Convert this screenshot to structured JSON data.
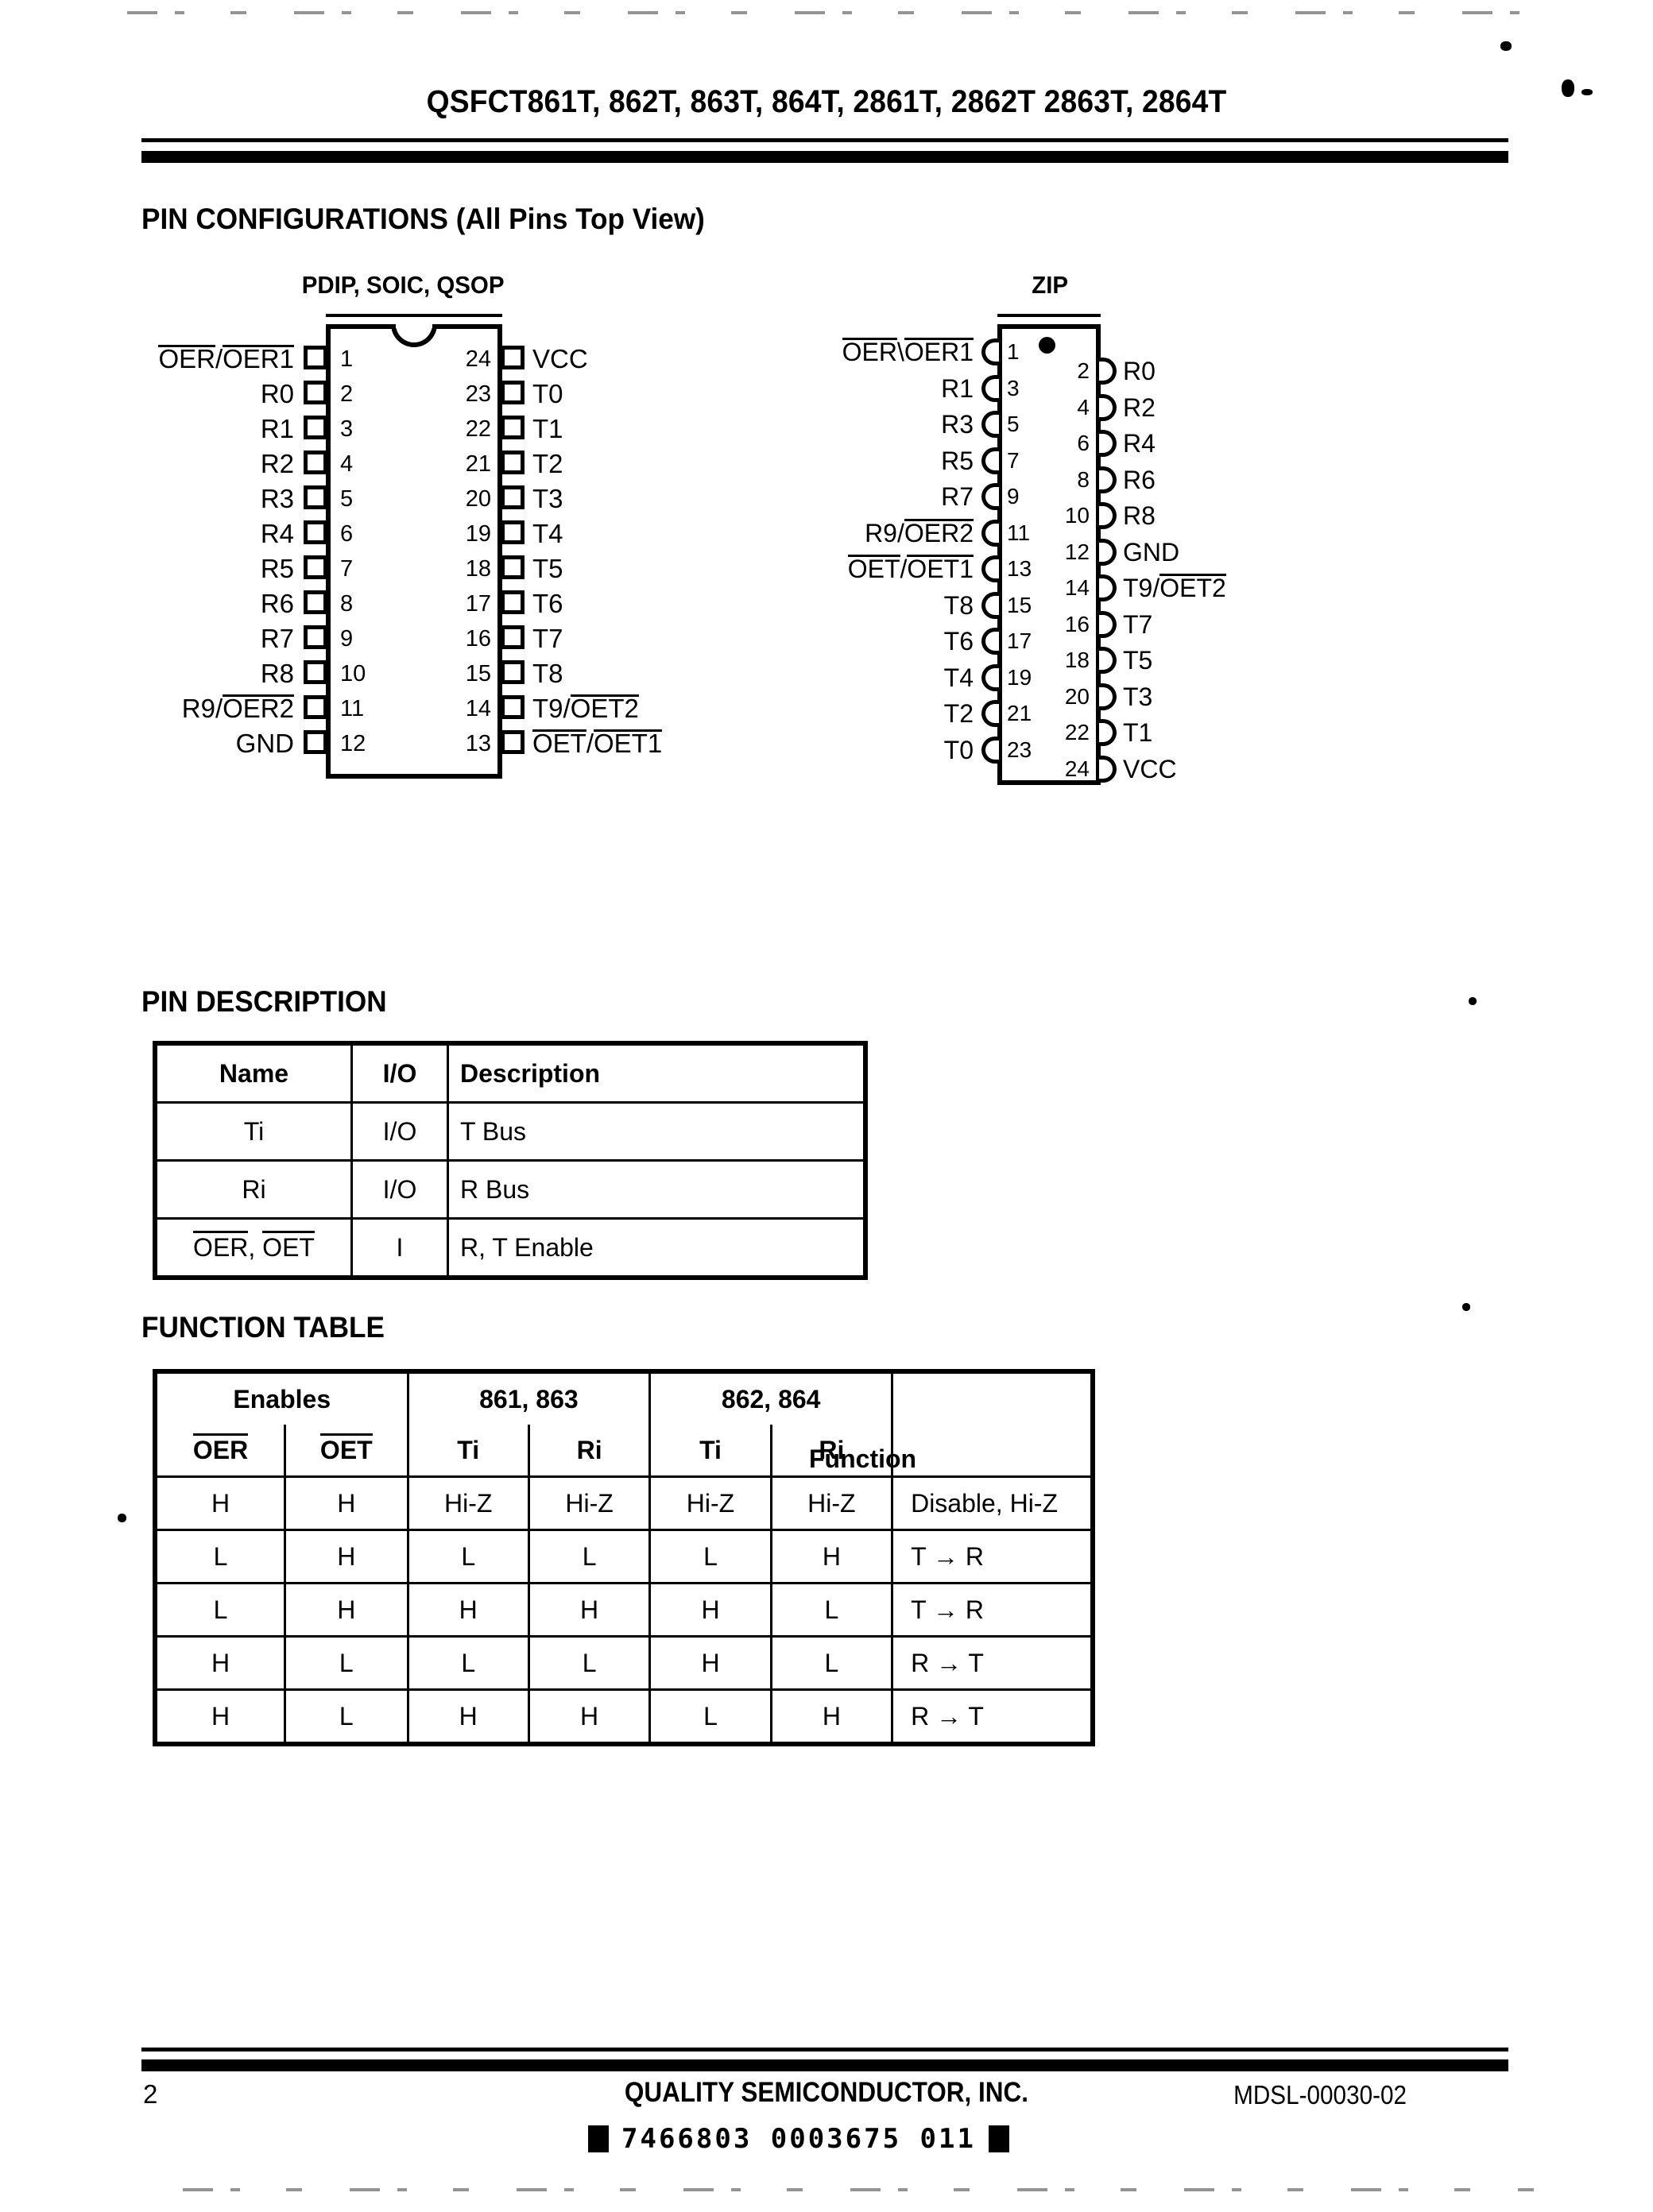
{
  "document": {
    "title": "QSFCT861T, 862T, 863T, 864T, 2861T, 2862T 2863T, 2864T",
    "page_number": "2",
    "company": "QUALITY SEMICONDUCTOR, INC.",
    "doc_code": "MDSL-00030-02",
    "ocr_code": "7466803 0003675 011"
  },
  "pin_configurations": {
    "heading": "PIN CONFIGURATIONS (All Pins Top View)",
    "dip": {
      "caption": "PDIP, SOIC, QSOP",
      "left_pins": [
        {
          "num": "1",
          "label": "OER/OER1",
          "overline": "both"
        },
        {
          "num": "2",
          "label": "R0",
          "overline": "none"
        },
        {
          "num": "3",
          "label": "R1",
          "overline": "none"
        },
        {
          "num": "4",
          "label": "R2",
          "overline": "none"
        },
        {
          "num": "5",
          "label": "R3",
          "overline": "none"
        },
        {
          "num": "6",
          "label": "R4",
          "overline": "none"
        },
        {
          "num": "7",
          "label": "R5",
          "overline": "none"
        },
        {
          "num": "8",
          "label": "R6",
          "overline": "none"
        },
        {
          "num": "9",
          "label": "R7",
          "overline": "none"
        },
        {
          "num": "10",
          "label": "R8",
          "overline": "none"
        },
        {
          "num": "11",
          "label": "R9/OER2",
          "overline": "second"
        },
        {
          "num": "12",
          "label": "GND",
          "overline": "none"
        }
      ],
      "right_pins": [
        {
          "num": "24",
          "label": "VCC",
          "overline": "none"
        },
        {
          "num": "23",
          "label": "T0",
          "overline": "none"
        },
        {
          "num": "22",
          "label": "T1",
          "overline": "none"
        },
        {
          "num": "21",
          "label": "T2",
          "overline": "none"
        },
        {
          "num": "20",
          "label": "T3",
          "overline": "none"
        },
        {
          "num": "19",
          "label": "T4",
          "overline": "none"
        },
        {
          "num": "18",
          "label": "T5",
          "overline": "none"
        },
        {
          "num": "17",
          "label": "T6",
          "overline": "none"
        },
        {
          "num": "16",
          "label": "T7",
          "overline": "none"
        },
        {
          "num": "15",
          "label": "T8",
          "overline": "none"
        },
        {
          "num": "14",
          "label": "T9/OET2",
          "overline": "second"
        },
        {
          "num": "13",
          "label": "OET/OET1",
          "overline": "both"
        }
      ]
    },
    "zip": {
      "caption": "ZIP",
      "left_pins": [
        {
          "num": "1",
          "label": "OER\\OER1",
          "overline": "both"
        },
        {
          "num": "3",
          "label": "R1",
          "overline": "none"
        },
        {
          "num": "5",
          "label": "R3",
          "overline": "none"
        },
        {
          "num": "7",
          "label": "R5",
          "overline": "none"
        },
        {
          "num": "9",
          "label": "R7",
          "overline": "none"
        },
        {
          "num": "11",
          "label": "R9/OER2",
          "overline": "second"
        },
        {
          "num": "13",
          "label": "OET/OET1",
          "overline": "both"
        },
        {
          "num": "15",
          "label": "T8",
          "overline": "none"
        },
        {
          "num": "17",
          "label": "T6",
          "overline": "none"
        },
        {
          "num": "19",
          "label": "T4",
          "overline": "none"
        },
        {
          "num": "21",
          "label": "T2",
          "overline": "none"
        },
        {
          "num": "23",
          "label": "T0",
          "overline": "none"
        }
      ],
      "right_pins": [
        {
          "num": "2",
          "label": "R0",
          "overline": "none"
        },
        {
          "num": "4",
          "label": "R2",
          "overline": "none"
        },
        {
          "num": "6",
          "label": "R4",
          "overline": "none"
        },
        {
          "num": "8",
          "label": "R6",
          "overline": "none"
        },
        {
          "num": "10",
          "label": "R8",
          "overline": "none"
        },
        {
          "num": "12",
          "label": "GND",
          "overline": "none"
        },
        {
          "num": "14",
          "label": "T9/OET2",
          "overline": "second"
        },
        {
          "num": "16",
          "label": "T7",
          "overline": "none"
        },
        {
          "num": "18",
          "label": "T5",
          "overline": "none"
        },
        {
          "num": "20",
          "label": "T3",
          "overline": "none"
        },
        {
          "num": "22",
          "label": "T1",
          "overline": "none"
        },
        {
          "num": "24",
          "label": "VCC",
          "overline": "none"
        }
      ]
    }
  },
  "pin_description": {
    "heading": "PIN DESCRIPTION",
    "columns": [
      "Name",
      "I/O",
      "Description"
    ],
    "rows": [
      {
        "name": "Ti",
        "name_overline": "none",
        "io": "I/O",
        "description": "T Bus"
      },
      {
        "name": "Ri",
        "name_overline": "none",
        "io": "I/O",
        "description": "R Bus"
      },
      {
        "name": "OER, OET",
        "name_overline": "both",
        "io": "I",
        "description": "R, T Enable"
      }
    ]
  },
  "function_table": {
    "heading": "FUNCTION TABLE",
    "group_headers": [
      "Enables",
      "861, 863",
      "862, 864",
      ""
    ],
    "sub_headers": [
      "OER",
      "OET",
      "Ti",
      "Ri",
      "Ti",
      "Ri",
      "Function"
    ],
    "rows": [
      [
        "H",
        "H",
        "Hi-Z",
        "Hi-Z",
        "Hi-Z",
        "Hi-Z",
        "Disable, Hi-Z"
      ],
      [
        "L",
        "H",
        "L",
        "L",
        "L",
        "H",
        "T → R"
      ],
      [
        "L",
        "H",
        "H",
        "H",
        "H",
        "L",
        "T → R"
      ],
      [
        "H",
        "L",
        "L",
        "L",
        "H",
        "L",
        "R → T"
      ],
      [
        "H",
        "L",
        "H",
        "H",
        "L",
        "H",
        "R → T"
      ]
    ]
  }
}
